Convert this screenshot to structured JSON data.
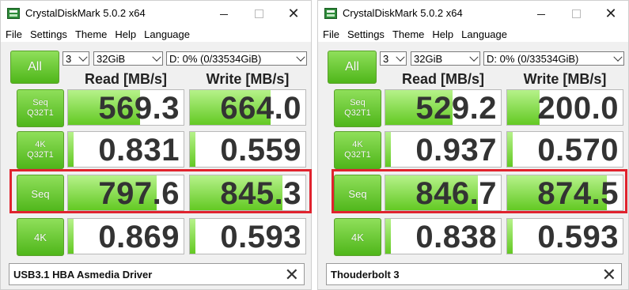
{
  "rows_meta": [
    "seq_q32t1",
    "k4_q32t1",
    "seq",
    "k4"
  ],
  "windows": [
    {
      "title": "CrystalDiskMark 5.0.2 x64",
      "menu": [
        "File",
        "Settings",
        "Theme",
        "Help",
        "Language"
      ],
      "all_label": "All",
      "count": "3",
      "size": "32GiB",
      "drive": "D: 0% (0/33534GiB)",
      "read_header": "Read [MB/s]",
      "write_header": "Write [MB/s]",
      "rows": [
        {
          "label1": "Seq",
          "label2": "Q32T1",
          "read": "569.3",
          "write": "664.0",
          "read_fill": 0.62,
          "write_fill": 0.7
        },
        {
          "label1": "4K",
          "label2": "Q32T1",
          "read": "0.831",
          "write": "0.559",
          "read_fill": 0.05,
          "write_fill": 0.05
        },
        {
          "label1": "Seq",
          "label2": "",
          "read": "797.6",
          "write": "845.3",
          "read_fill": 0.77,
          "write_fill": 0.8
        },
        {
          "label1": "4K",
          "label2": "",
          "read": "0.869",
          "write": "0.593",
          "read_fill": 0.05,
          "write_fill": 0.05
        }
      ],
      "comment": "USB3.1 HBA Asmedia Driver"
    },
    {
      "title": "CrystalDiskMark 5.0.2 x64",
      "menu": [
        "File",
        "Settings",
        "Theme",
        "Help",
        "Language"
      ],
      "all_label": "All",
      "count": "3",
      "size": "32GiB",
      "drive": "D: 0% (0/33534GiB)",
      "read_header": "Read [MB/s]",
      "write_header": "Write [MB/s]",
      "rows": [
        {
          "label1": "Seq",
          "label2": "Q32T1",
          "read": "529.2",
          "write": "200.0",
          "read_fill": 0.58,
          "write_fill": 0.28
        },
        {
          "label1": "4K",
          "label2": "Q32T1",
          "read": "0.937",
          "write": "0.570",
          "read_fill": 0.05,
          "write_fill": 0.05
        },
        {
          "label1": "Seq",
          "label2": "",
          "read": "846.7",
          "write": "874.5",
          "read_fill": 0.8,
          "write_fill": 0.86
        },
        {
          "label1": "4K",
          "label2": "",
          "read": "0.838",
          "write": "0.593",
          "read_fill": 0.05,
          "write_fill": 0.05
        }
      ],
      "comment": "Thouderbolt 3"
    }
  ],
  "colors": {
    "accent_green": "#4fb61a",
    "highlight_red": "#e0232e"
  }
}
